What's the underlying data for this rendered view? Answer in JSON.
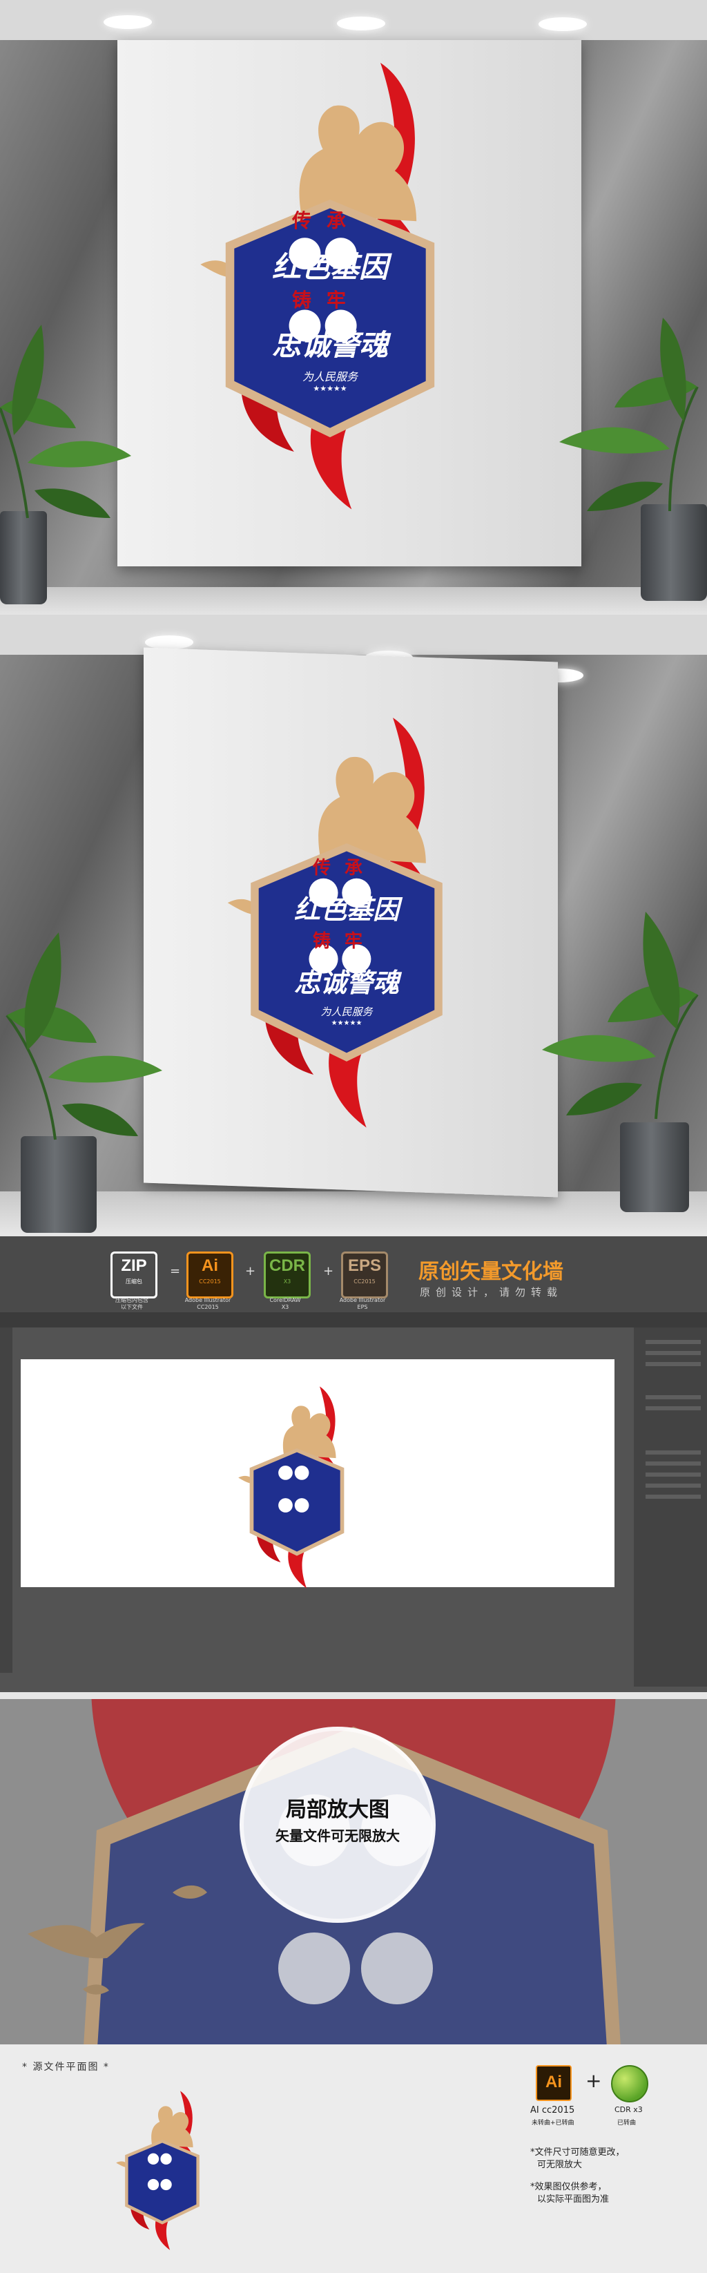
{
  "artwork": {
    "line1_char1": "传",
    "line1_char2": "承",
    "line2": "红色基因",
    "line3_char1": "铸",
    "line3_char2": "牢",
    "line4": "忠诚警魂",
    "signature": "为人民服务",
    "stars": "★★★★★"
  },
  "formats": [
    {
      "badge": "ZIP",
      "sub": "压缩包",
      "caption": "压缩包内包含\n以下文件"
    },
    {
      "badge": "Ai",
      "sub": "CC2015",
      "caption": "Adobe Illustrator\nCC2015"
    },
    {
      "badge": "CDR",
      "sub": "X3",
      "caption": "CorelDRAW\nX3"
    },
    {
      "badge": "EPS",
      "sub": "CC2015",
      "caption": "Adobe Illustrator\nEPS"
    }
  ],
  "operators": [
    "=",
    "+",
    "+"
  ],
  "brand": {
    "title": "原创矢量文化墙",
    "subtitle": "原创设计，请勿转载"
  },
  "zoom": {
    "title": "局部放大图",
    "subtitle": "矢量文件可无限放大"
  },
  "bottom": {
    "source_label": "* 源文件平面图 *",
    "ai_version": "AI cc2015",
    "ai_note": "未转曲+已转曲",
    "cdr_version": "CDR x3",
    "cdr_note": "已转曲",
    "note1_line1": "*文件尺寸可随意更改，",
    "note1_line2": "可无限放大",
    "note2_line1": "*效果图仅供参考，",
    "note2_line2": "以实际平面图为准"
  },
  "colors": {
    "hex_blue": "#1f2f8f",
    "hex_border": "#d8b48c",
    "ribbon_red": "#d8151c",
    "gold": "#dcb17c",
    "ai_orange": "#f7941d",
    "cdr_green": "#7ab648",
    "brand_orange": "#f39a2b"
  }
}
